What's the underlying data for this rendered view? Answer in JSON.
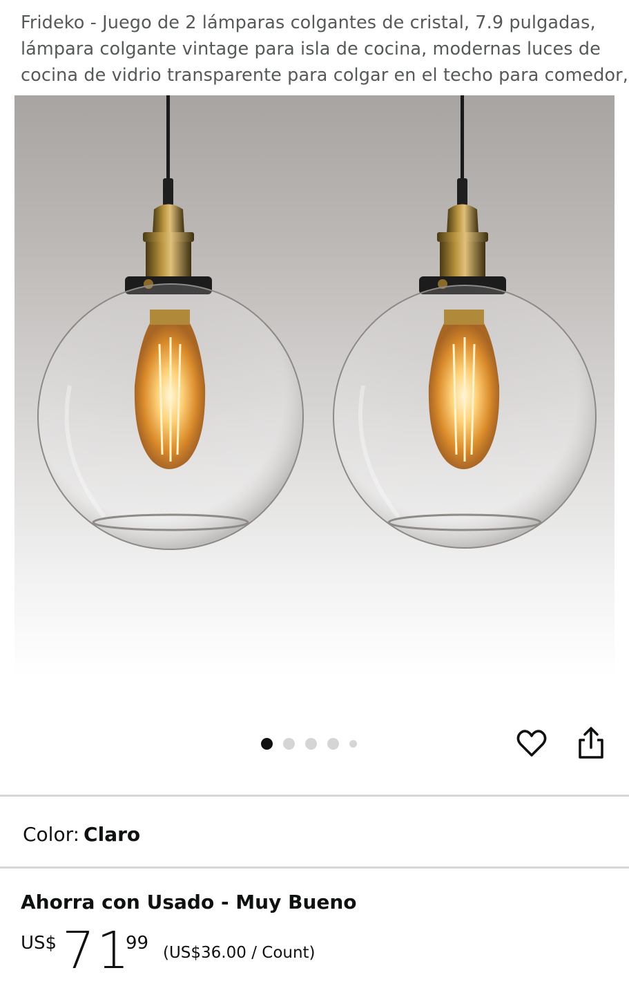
{
  "product": {
    "title_lines": [
      "Frideko - Juego de 2 lámparas colgantes de cristal, 7.9 pulgadas,",
      "lámpara colgante vintage para isla de cocina, modernas luces de",
      "cocina de vidrio transparente para colgar en el techo para comedor,"
    ]
  },
  "gallery": {
    "image_count": 5,
    "active_index": 0
  },
  "actions": {
    "wishlist_icon": "heart-outline-icon",
    "share_icon": "share-icon"
  },
  "color": {
    "label": "Color:",
    "value": "Claro"
  },
  "offer": {
    "title": "Ahorra con Usado - Muy Bueno",
    "currency": "US$",
    "whole": "71",
    "fraction": "99",
    "unit_price": "(US$36.00 / Count)"
  }
}
